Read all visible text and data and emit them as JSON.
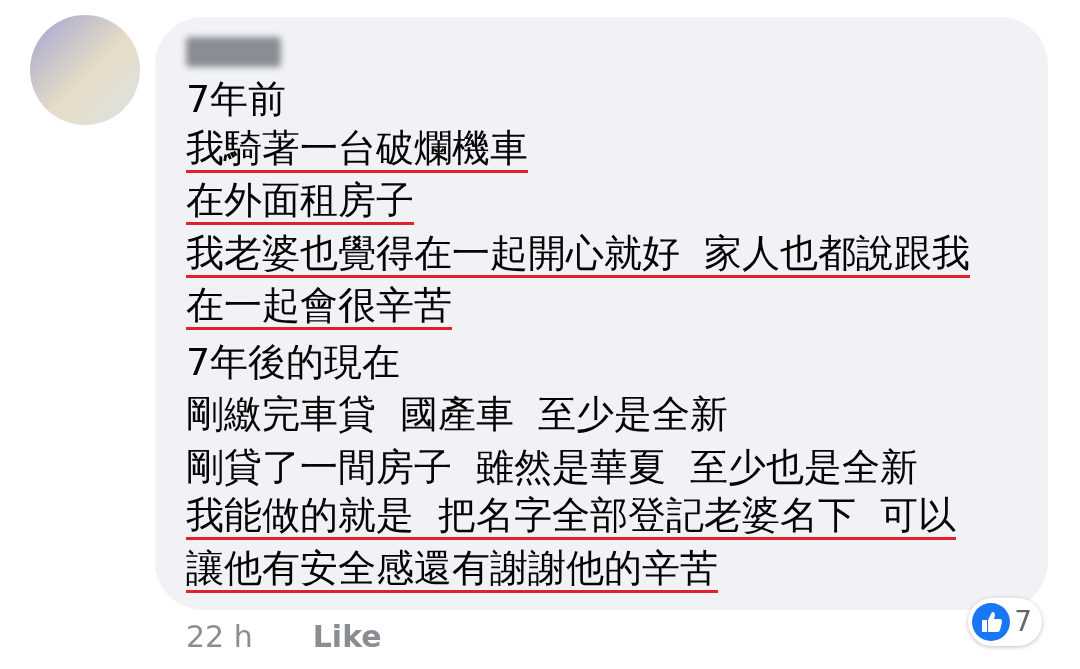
{
  "comment": {
    "lines": [
      {
        "text": "7年前",
        "underlined": false
      },
      {
        "text": "我騎著一台破爛機車",
        "underlined": true
      },
      {
        "text": "在外面租房子",
        "underlined": true
      },
      {
        "text": "我老婆也覺得在一起開心就好  家人也都說跟我",
        "underlined": true
      },
      {
        "text": "在一起會很辛苦",
        "underlined": true
      },
      {
        "text": "7年後的現在",
        "underlined": false
      },
      {
        "text": "剛繳完車貸  國產車  至少是全新",
        "underlined": false
      },
      {
        "text": "剛貸了一間房子  雖然是華夏  至少也是全新",
        "underlined": false
      },
      {
        "text": "我能做的就是  把名字全部登記老婆名下  可以",
        "underlined": true
      },
      {
        "text": "讓他有安全感還有謝謝他的辛苦",
        "underlined": true
      }
    ],
    "time": "22 h",
    "like": "Like",
    "reaction_count": "7"
  }
}
